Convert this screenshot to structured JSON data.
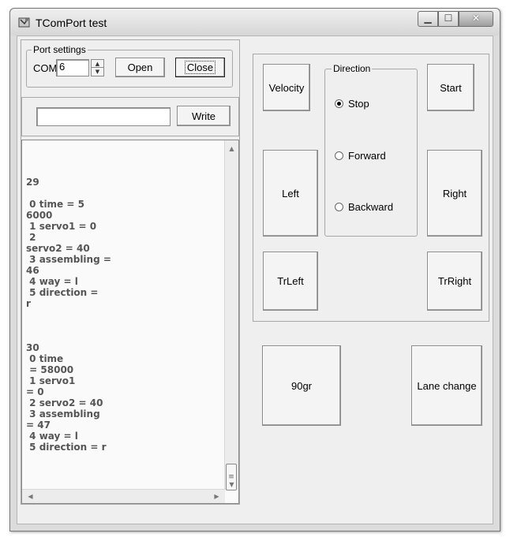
{
  "window": {
    "title": "TComPort test"
  },
  "title_buttons": {
    "minimize_glyph": "▁",
    "maximize_glyph": "☐",
    "close_glyph": "✕"
  },
  "port_settings": {
    "legend": "Port settings",
    "com_label": "COM",
    "com_value": "6",
    "open_label": "Open",
    "close_label": "Close"
  },
  "write_bar": {
    "input_value": "",
    "write_label": "Write"
  },
  "log": {
    "text": "\n\n\n29\n\n 0 time = 5\n6000\n 1 servo1 = 0\n 2\nservo2 = 40\n 3 assembling =\n46\n 4 way = l\n 5 direction =\nr\n\n\n\n30\n 0 time\n = 58000\n 1 servo1\n= 0\n 2 servo2 = 40\n 3 assembling\n= 47\n 4 way = l\n 5 direction = r"
  },
  "controls": {
    "velocity_label": "Velocity",
    "start_label": "Start",
    "left_label": "Left",
    "right_label": "Right",
    "trleft_label": "TrLeft",
    "trright_label": "TrRight"
  },
  "direction": {
    "legend": "Direction",
    "options": [
      {
        "label": "Stop",
        "checked": true
      },
      {
        "label": "Forward",
        "checked": false
      },
      {
        "label": "Backward",
        "checked": false
      }
    ]
  },
  "actions": {
    "turn90_label": "90gr",
    "lane_change_label": "Lane change"
  }
}
